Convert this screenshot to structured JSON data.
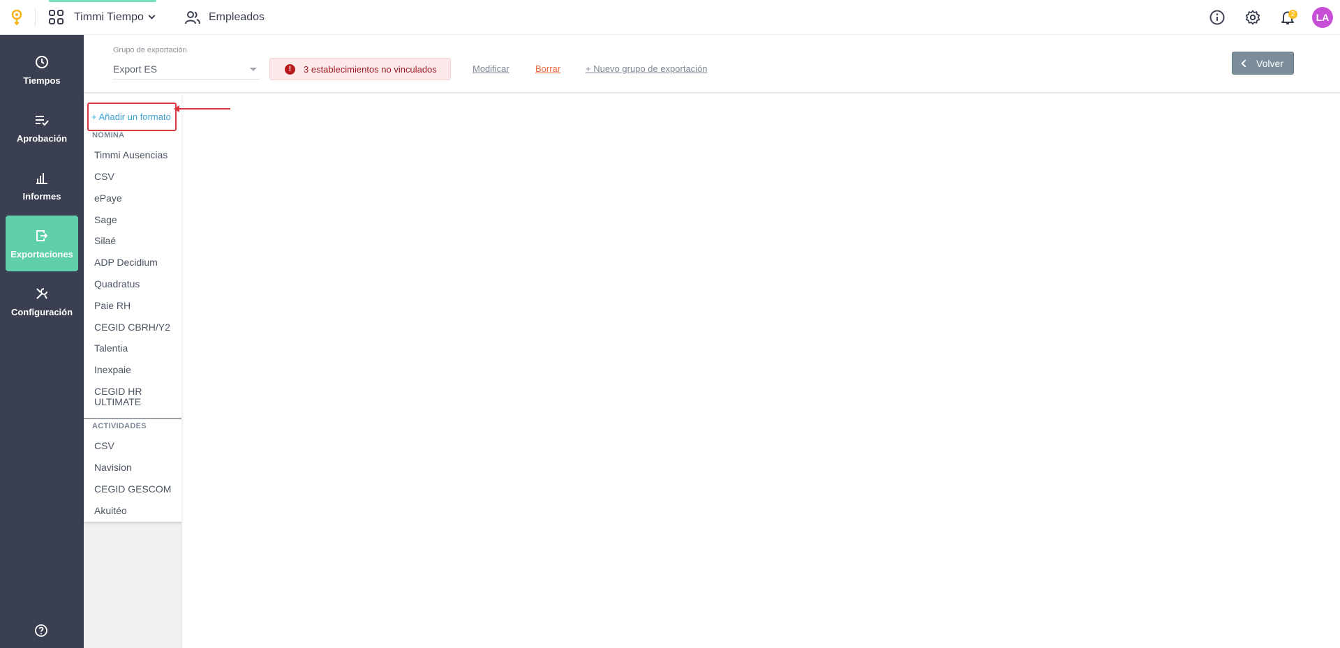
{
  "header": {
    "app_name": "Timmi Tiempo",
    "employees_label": "Empleados",
    "notifications_count": "2",
    "avatar_initials": "LA",
    "icons": [
      "logo-icon",
      "apps-grid-icon",
      "chevron-down-icon",
      "users-icon",
      "info-icon",
      "gear-icon",
      "bell-icon"
    ]
  },
  "sidebar": {
    "items": [
      {
        "label": "Tiempos",
        "icon": "clock-icon",
        "active": false
      },
      {
        "label": "Aprobación",
        "icon": "list-check-icon",
        "active": false
      },
      {
        "label": "Informes",
        "icon": "bar-chart-icon",
        "active": false
      },
      {
        "label": "Exportaciones",
        "icon": "export-icon",
        "active": true
      },
      {
        "label": "Configuración",
        "icon": "tools-icon",
        "active": false
      }
    ],
    "help_icon": "help-circle-icon"
  },
  "toolbar": {
    "group_label": "Grupo de exportación",
    "group_value": "Export ES",
    "alert_text": "3 establecimientos no vinculados",
    "modify_label": "Modificar",
    "delete_label": "Borrar",
    "new_group_label": "+ Nuevo grupo de exportación",
    "back_label": "Volver"
  },
  "formats": {
    "add_label": "+ Añadir un formato",
    "payroll_title": "NÓMINA",
    "payroll": [
      "Timmi Ausencias",
      "CSV",
      "ePaye",
      "Sage",
      "Silaé",
      "ADP Decidium",
      "Quadratus",
      "Paie RH",
      "CEGID CBRH/Y2",
      "Talentia",
      "Inexpaie",
      "CEGID HR ULTIMATE"
    ],
    "activities_title": "ACTIVIDADES",
    "activities": [
      "CSV",
      "Navision",
      "CEGID GESCOM",
      "Akuitéo"
    ]
  },
  "colors": {
    "sidebar_bg": "#3a3f51",
    "active_nav": "#5fcfab",
    "alert_bg": "#fde8ea",
    "link_blue": "#3ba3d8",
    "delete_orange": "#f26b3a",
    "highlight_red": "#d9363e",
    "avatar": "#c64fd6"
  }
}
